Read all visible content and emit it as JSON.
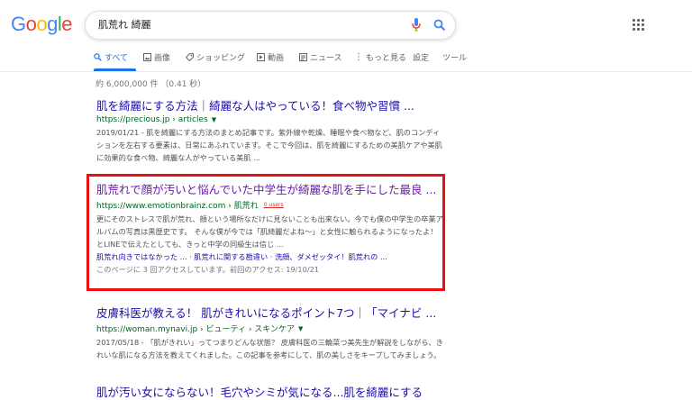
{
  "logo": {
    "letters": [
      "G",
      "o",
      "o",
      "g",
      "l",
      "e"
    ],
    "colors": [
      "#4285F4",
      "#EA4335",
      "#FBBC05",
      "#4285F4",
      "#34A853",
      "#EA4335"
    ]
  },
  "search": {
    "query": "肌荒れ 綺麗",
    "mic_icon": "mic-icon",
    "search_icon": "search-icon"
  },
  "tabs": [
    {
      "label": "すべて",
      "icon": "search-icon"
    },
    {
      "label": "画像",
      "icon": "image-icon"
    },
    {
      "label": "ショッピング",
      "icon": "tag-icon"
    },
    {
      "label": "動画",
      "icon": "video-icon"
    },
    {
      "label": "ニュース",
      "icon": "news-icon"
    },
    {
      "label": "もっと見る",
      "icon": "more-icon"
    },
    {
      "label": "設定",
      "icon": ""
    },
    {
      "label": "ツール",
      "icon": ""
    }
  ],
  "stats": "約 6,000,000 件 （0.41 秒）",
  "results": [
    {
      "title": "肌を綺麗にする方法｜綺麗な人はやっている！食べ物や習慣 ...",
      "url": "https://precious.jp › articles",
      "snippet": "2019/01/21 - 肌を綺麗にする方法のまとめ記事です。紫外線や乾燥、睡眠や食べ物など、肌のコンディションを左右する要素は、日常にあふれています。そこで今回は、肌を綺麗にするための美肌ケアや美肌に効果的な食べ物、綺麗な人がやっている美肌 ..."
    },
    {
      "title": "肌荒れで顔が汚いと悩んでいた中学生が綺麗な肌を手にした最良 ...",
      "url": "https://www.emotionbrainz.com › 肌荒れ",
      "tag": "0 users",
      "snippet": "更にそのストレスで肌が荒れ、顔という場所なだけに見ないことも出来ない。今でも僕の中学生の卒業アルバムの写真は黒歴史です。 そんな僕が今では「肌綺麗だよね〜」と女性に触られるようになったよ！とLINEで伝えたとしても、きっと中学の同級生は信じ ...",
      "links": "肌荒れ向きではなかった ... · 肌荒れに関する勘違い · 洗顔、ダメゼッタイ！肌荒れの ...",
      "visit": "このページに 3 回アクセスしています。前回のアクセス: 19/10/21"
    },
    {
      "title": "皮膚科医が教える！ 肌がきれいになるポイント7つ｜「マイナビ ...",
      "url": "https://woman.mynavi.jp › ビューティ › スキンケア",
      "snippet": "2017/05/18 - 「肌がきれい」ってつまりどんな状態？ 皮膚科医の三輪菜つ美先生が解説をしながら、きれいな肌になる方法を教えてくれました。この記事を参考にして、肌の美しさをキープしてみましょう。"
    },
    {
      "title": "肌が汚い女にならない！毛穴やシミが気になる...肌を綺麗にする"
    }
  ]
}
